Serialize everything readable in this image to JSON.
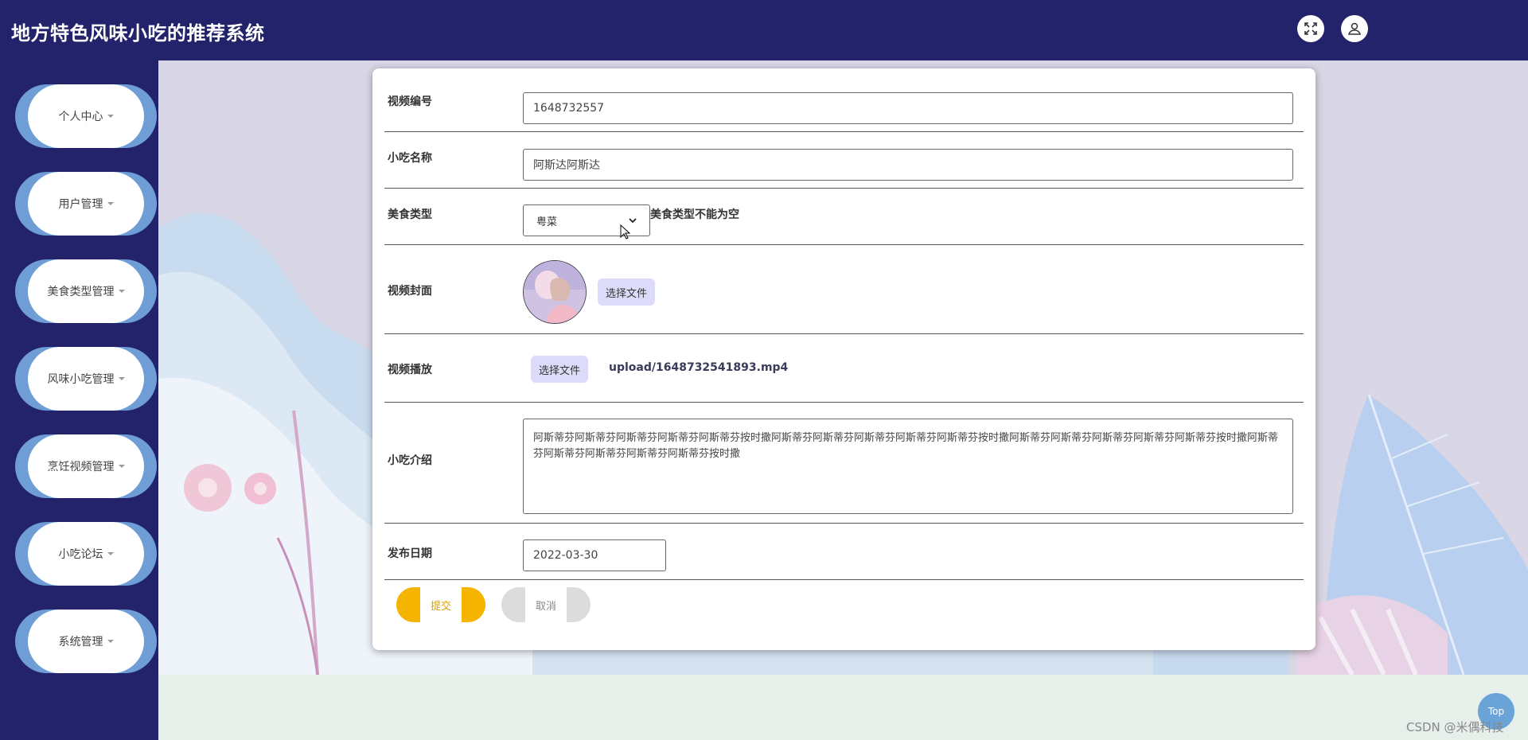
{
  "app": {
    "title": "地方特色风味小吃的推荐系统"
  },
  "header": {
    "fullscreen_icon": "expand-icon",
    "user_icon": "user-icon"
  },
  "sidebar": {
    "items": [
      {
        "label": "个人中心"
      },
      {
        "label": "用户管理"
      },
      {
        "label": "美食类型管理"
      },
      {
        "label": "风味小吃管理"
      },
      {
        "label": "烹饪视频管理"
      },
      {
        "label": "小吃论坛"
      },
      {
        "label": "系统管理"
      }
    ]
  },
  "form": {
    "video_no": {
      "label": "视频编号",
      "value": "1648732557"
    },
    "snack_name": {
      "label": "小吃名称",
      "value": "阿斯达阿斯达"
    },
    "food_type": {
      "label": "美食类型",
      "value": "粤菜",
      "error": "美食类型不能为空"
    },
    "cover": {
      "label": "视频封面",
      "button": "选择文件"
    },
    "video": {
      "label": "视频播放",
      "button": "选择文件",
      "filename": "upload/1648732541893.mp4"
    },
    "intro": {
      "label": "小吃介绍",
      "value": "阿斯蒂芬阿斯蒂芬阿斯蒂芬阿斯蒂芬阿斯蒂芬按时撒阿斯蒂芬阿斯蒂芬阿斯蒂芬阿斯蒂芬阿斯蒂芬按时撒阿斯蒂芬阿斯蒂芬阿斯蒂芬阿斯蒂芬阿斯蒂芬按时撒阿斯蒂芬阿斯蒂芬阿斯蒂芬阿斯蒂芬阿斯蒂芬按时撒"
    },
    "publish_date": {
      "label": "发布日期",
      "value": "2022-03-30"
    },
    "submit": "提交",
    "cancel": "取消"
  },
  "misc": {
    "top_button": "Top",
    "watermark": "CSDN @米偶科技"
  },
  "colors": {
    "header_bg": "#22236a",
    "accent_submit": "#f5b400",
    "cancel_bg": "#dcdcdc",
    "sidebar_pill": "#6f9ed6"
  }
}
